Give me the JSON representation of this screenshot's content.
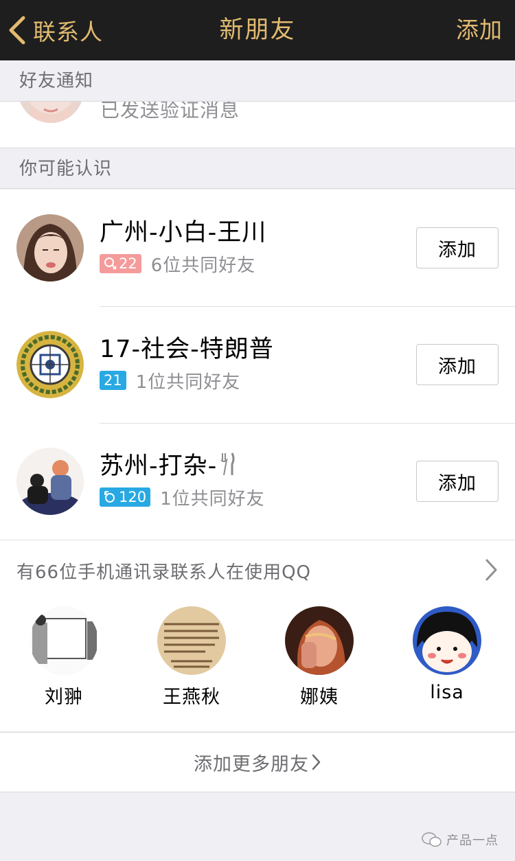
{
  "nav": {
    "back_label": "联系人",
    "title": "新朋友",
    "action_label": "添加"
  },
  "friend_notifications": {
    "header": "好友通知",
    "items": [
      {
        "status": "已发送验证消息"
      }
    ]
  },
  "may_know": {
    "header": "你可能认识",
    "items": [
      {
        "name": "广州-小白-王川",
        "gender": "female",
        "badge": "22",
        "badge_color": "#f59b9b",
        "mutual": "6位共同好友",
        "button": "添加"
      },
      {
        "name": "17-社会-特朗普",
        "gender": "",
        "badge": "21",
        "badge_color": "#28a9e3",
        "mutual": "1位共同好友",
        "button": "添加"
      },
      {
        "name": "苏州-打杂-",
        "name_icon": "fork-knife-icon",
        "gender": "male",
        "badge": "120",
        "badge_color": "#28a9e3",
        "mutual": "1位共同好友",
        "button": "添加"
      }
    ]
  },
  "phone_contacts": {
    "header": "有66位手机通讯录联系人在使用QQ",
    "contacts": [
      {
        "name": "刘翀"
      },
      {
        "name": "王燕秋",
        "avatar_text": "Sometimes I just want someone to hug me and say, \"I know it's hard. You're going to be okay. Here's a coffee. And 5 million dollars.\""
      },
      {
        "name": "娜姨"
      },
      {
        "name": "lisa"
      }
    ]
  },
  "more_friends": {
    "label": "添加更多朋友"
  },
  "watermark": {
    "label": "产品一点"
  },
  "colors": {
    "nav_bg": "#1e1e1f",
    "nav_accent": "#e2bb6f",
    "page_bg": "#efeff4"
  }
}
